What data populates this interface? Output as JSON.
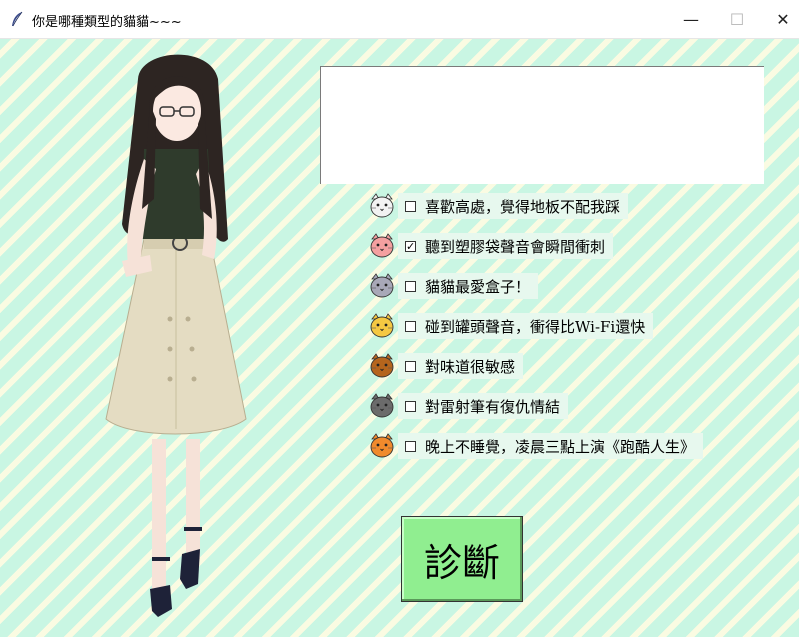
{
  "window": {
    "title": "你是哪種類型的貓貓~~~",
    "minimize_glyph": "—",
    "maximize_glyph": "☐",
    "close_glyph": "✕"
  },
  "result_box": {
    "value": ""
  },
  "options": [
    {
      "label": "喜歡高處，覺得地板不配我踩",
      "checked": false,
      "icon": "white-cat-icon",
      "color": "#f2f2f2"
    },
    {
      "label": "聽到塑膠袋聲音會瞬間衝刺",
      "checked": true,
      "icon": "pink-cat-icon",
      "color": "#f4a0a0"
    },
    {
      "label": "貓貓最愛盒子！",
      "checked": false,
      "icon": "gray-cat-icon",
      "color": "#a8a8b8"
    },
    {
      "label": "碰到罐頭聲音，衝得比Wi-Fi還快",
      "checked": false,
      "icon": "yellow-cat-icon",
      "color": "#f5c842"
    },
    {
      "label": "對味道很敏感",
      "checked": false,
      "icon": "brown-cat-icon",
      "color": "#b5651d"
    },
    {
      "label": "對雷射筆有復仇情結",
      "checked": false,
      "icon": "dark-gray-cat-icon",
      "color": "#6b6b6b"
    },
    {
      "label": "晚上不睡覺，凌晨三點上演《跑酷人生》",
      "checked": false,
      "icon": "orange-tabby-cat-icon",
      "color": "#f08a2c"
    }
  ],
  "diagnose_button": {
    "label": "診斷",
    "color": "#90ee90"
  },
  "colors": {
    "stripe_mint": "#c9f6e3",
    "stripe_cream": "#fafbe2"
  }
}
